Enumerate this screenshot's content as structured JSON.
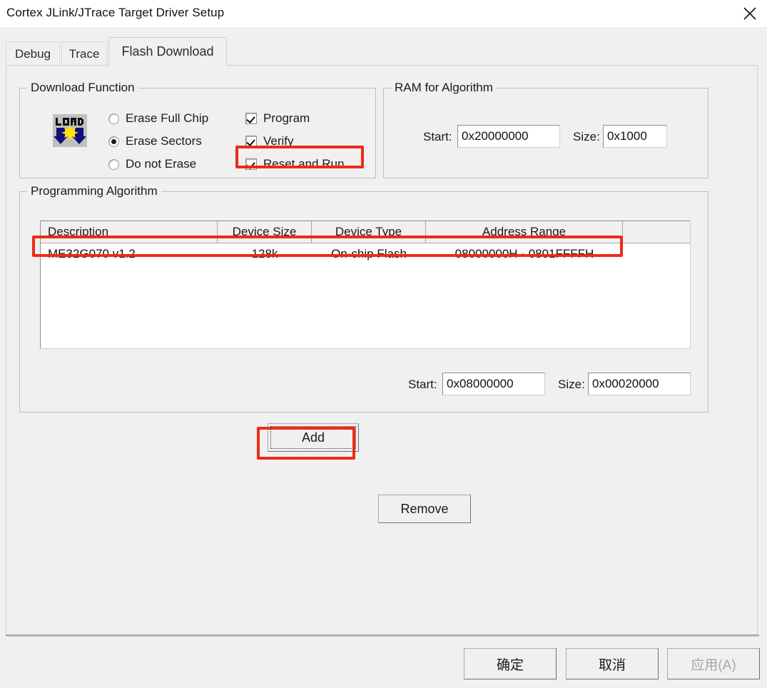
{
  "window": {
    "title": "Cortex JLink/JTrace Target Driver Setup",
    "close_icon": "close-icon"
  },
  "tabs": [
    {
      "label": "Debug",
      "active": false
    },
    {
      "label": "Trace",
      "active": false
    },
    {
      "label": "Flash Download",
      "active": true
    }
  ],
  "download_function": {
    "legend": "Download Function",
    "icon": "load-icon",
    "radios": [
      {
        "label": "Erase Full Chip",
        "checked": false
      },
      {
        "label": "Erase Sectors",
        "checked": true
      },
      {
        "label": "Do not Erase",
        "checked": false
      }
    ],
    "checkboxes": [
      {
        "label": "Program",
        "checked": true
      },
      {
        "label": "Verify",
        "checked": true
      },
      {
        "label": "Reset and Run",
        "checked": true,
        "highlighted": true
      }
    ]
  },
  "ram_for_algorithm": {
    "legend": "RAM for Algorithm",
    "start_label": "Start:",
    "start_value": "0x20000000",
    "size_label": "Size:",
    "size_value": "0x1000"
  },
  "programming_algorithm": {
    "legend": "Programming Algorithm",
    "columns": [
      "Description",
      "Device Size",
      "Device Type",
      "Address Range",
      ""
    ],
    "rows": [
      {
        "description": "ME32G070 v1.2",
        "device_size": "128k",
        "device_type": "On-chip Flash",
        "address_range": "08000000H - 0801FFFFH",
        "extra": "",
        "highlighted": true
      }
    ],
    "start_label": "Start:",
    "start_value": "0x08000000",
    "size_label": "Size:",
    "size_value": "0x00020000"
  },
  "actions": {
    "add_label": "Add",
    "remove_label": "Remove"
  },
  "footer": {
    "ok_label": "确定",
    "cancel_label": "取消",
    "apply_label": "应用(A)",
    "apply_disabled": true
  },
  "colors": {
    "annotation": "#ee2a17",
    "dialog_background": "#f0f0f0",
    "field_background": "#ffffff"
  }
}
